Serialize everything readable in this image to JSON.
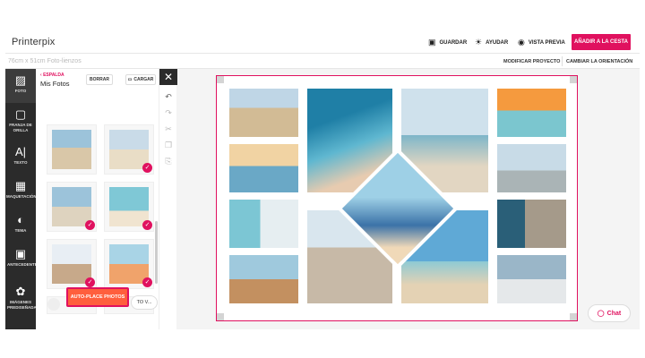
{
  "app": {
    "logo": "Printerpix"
  },
  "header": {
    "save": "GUARDAR",
    "help": "AYUDAR",
    "preview": "VISTA PREVIA",
    "add_to_cart": "AÑADIR A LA CESTA",
    "product_size": "76cm x 51cm Foto-lienzos",
    "modify": "MODIFICAR PROYECTO",
    "orientation": "CAMBIAR LA ORIENTACIÓN"
  },
  "rail": [
    {
      "label": "FOTO",
      "icon": "photo-icon",
      "glyph": "▨"
    },
    {
      "label": "FRANJA DE ORILLA",
      "icon": "border-icon",
      "glyph": "▢"
    },
    {
      "label": "TEXTO",
      "icon": "text-icon",
      "glyph": "A|"
    },
    {
      "label": "MAQUETACIÓN",
      "icon": "layout-icon",
      "glyph": "▦"
    },
    {
      "label": "TEMA",
      "icon": "palette-icon",
      "glyph": "◐"
    },
    {
      "label": "ANTECEDENTES",
      "icon": "background-icon",
      "glyph": "▣"
    },
    {
      "label": "IMÁGENES PREDISEÑADAS",
      "icon": "clipart-icon",
      "glyph": "✿"
    }
  ],
  "panel": {
    "back": "ESPALDA",
    "title": "Mis Fotos",
    "clear": "BORRAR",
    "upload": "CARGAR",
    "auto_place": "AUTO-PLACE PHOTOS",
    "pill_text": "TO V...",
    "thumbnails": [
      {
        "colors": [
          "#d9c7a8",
          "#6e9bbd"
        ],
        "checked": false
      },
      {
        "colors": [
          "#c9dbe8",
          "#e9ddc6"
        ],
        "checked": true
      },
      {
        "colors": [
          "#ded3bf",
          "#9cc3da"
        ],
        "checked": true
      },
      {
        "colors": [
          "#5fb7c4",
          "#f0e4d0"
        ],
        "checked": true
      },
      {
        "colors": [
          "#e8eef4",
          "#c7a98a"
        ],
        "checked": true
      },
      {
        "colors": [
          "#a9d4e6",
          "#f0a36b"
        ],
        "checked": true
      }
    ]
  },
  "tools": {
    "close": "✕"
  },
  "chat": {
    "label": "Chat"
  },
  "colors": {
    "accent": "#e0115f",
    "rail": "#2b2b2b",
    "orange": "#ff5f3d"
  }
}
